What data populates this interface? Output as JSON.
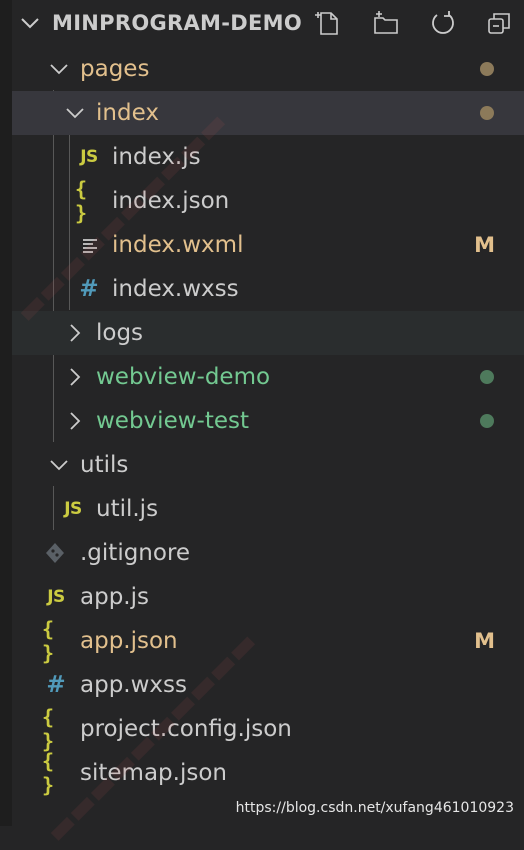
{
  "header": {
    "title": "MINPROGRAM-DEMO",
    "actions": [
      "new-file-icon",
      "new-folder-icon",
      "refresh-icon",
      "collapse-all-icon"
    ]
  },
  "tree": {
    "pages": {
      "label": "pages",
      "status": "modified-dot"
    },
    "index": {
      "label": "index",
      "status": "modified-dot"
    },
    "index_js": {
      "label": "index.js",
      "icon": "JS"
    },
    "index_json": {
      "label": "index.json",
      "icon": "{ }"
    },
    "index_wxml": {
      "label": "index.wxml",
      "badge": "M"
    },
    "index_wxss": {
      "label": "index.wxss",
      "icon": "#"
    },
    "logs": {
      "label": "logs"
    },
    "webview_demo": {
      "label": "webview-demo",
      "status": "untracked-dot"
    },
    "webview_test": {
      "label": "webview-test",
      "status": "untracked-dot"
    },
    "utils": {
      "label": "utils"
    },
    "util_js": {
      "label": "util.js",
      "icon": "JS"
    },
    "gitignore": {
      "label": ".gitignore"
    },
    "app_js": {
      "label": "app.js",
      "icon": "JS"
    },
    "app_json": {
      "label": "app.json",
      "badge": "M",
      "icon": "{ }"
    },
    "app_wxss": {
      "label": "app.wxss",
      "icon": "#"
    },
    "project_config": {
      "label": "project.config.json",
      "icon": "{ }"
    },
    "sitemap": {
      "label": "sitemap.json",
      "icon": "{ }"
    }
  },
  "colors": {
    "modified": "#e2c08d",
    "untracked": "#73c991",
    "default_text": "#cccccc",
    "modified_dot": "#8c7a5a",
    "untracked_dot": "#4e7a5c",
    "js_icon": "#cbcb41",
    "css_icon": "#519aba"
  },
  "watermark_url": "https://blog.csdn.net/xufang461010923"
}
